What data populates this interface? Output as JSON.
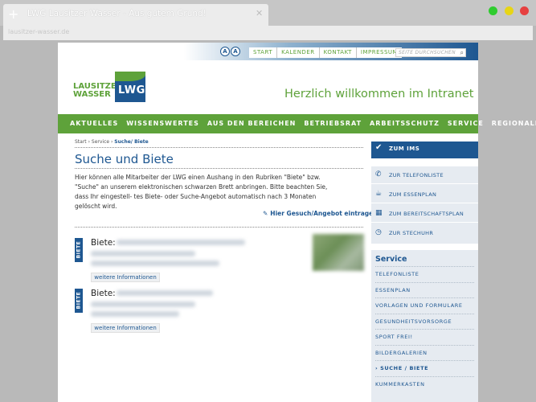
{
  "browser": {
    "tab_title": "LWG Lausitzer Wasser - Aus gutem Grund!",
    "url": "lausitzer-wasser.de",
    "new_tab_glyph": "+",
    "close_glyph": "✕"
  },
  "header": {
    "font_small": "A",
    "font_large": "A",
    "topnav": [
      "START",
      "KALENDER",
      "KONTAKT",
      "IMPRESSUM"
    ],
    "search_placeholder": "SEITE DURCHSUCHEN",
    "logo_line1": "LAUSITZER",
    "logo_line2": "WASSER",
    "logo_mark": "LWG",
    "welcome": "Herzlich willkommen im Intranet"
  },
  "mainnav": [
    "AKTUELLES",
    "WISSENSWERTES",
    "AUS DEN BEREICHEN",
    "BETRIEBSRAT",
    "ARBEITSSCHUTZ",
    "SERVICE",
    "REGIONALES"
  ],
  "content": {
    "breadcrumb_start": "Start",
    "breadcrumb_sep": " › ",
    "breadcrumb_service": "Service",
    "breadcrumb_current": "Suche/ Biete",
    "title": "Suche und Biete",
    "intro": "Hier können alle Mitarbeiter der LWG einen Aushang in den Rubriken \"Biete\" bzw. \"Suche\" an unserem elektronischen schwarzen Brett anbringen. Bitte beachten Sie, dass Ihr eingestell- tes Biete- oder Suche-Angebot automatisch nach 3 Monaten gelöscht wird.",
    "post_link": "Hier Gesuch/Angebot eintragen!",
    "items": [
      {
        "tag": "BIETE",
        "title": "Biete:",
        "more": "weitere Informationen"
      },
      {
        "tag": "BIETE",
        "title": "Biete:",
        "more": "weitere Informationen"
      }
    ]
  },
  "sidebar": {
    "ims": "ZUM IMS",
    "quick": [
      {
        "icon": "phone-icon",
        "label": "ZUR TELEFONLISTE"
      },
      {
        "icon": "food-icon",
        "label": "ZUM ESSENPLAN"
      },
      {
        "icon": "calendar-icon",
        "label": "ZUM BEREITSCHAFTSPLAN"
      },
      {
        "icon": "clock-icon",
        "label": "ZUR STECHUHR"
      }
    ],
    "service_title": "Service",
    "service_links": [
      "TELEFONLISTE",
      "ESSENPLAN",
      "VORLAGEN UND FORMULARE",
      "GESUNDHEITSVORSORGE",
      "SPORT FREI!",
      "BILDERGALERIEN",
      "› SUCHE / BIETE",
      "KUMMERKASTEN"
    ]
  },
  "colors": {
    "green": "#5ea23a",
    "blue": "#1e5791"
  }
}
